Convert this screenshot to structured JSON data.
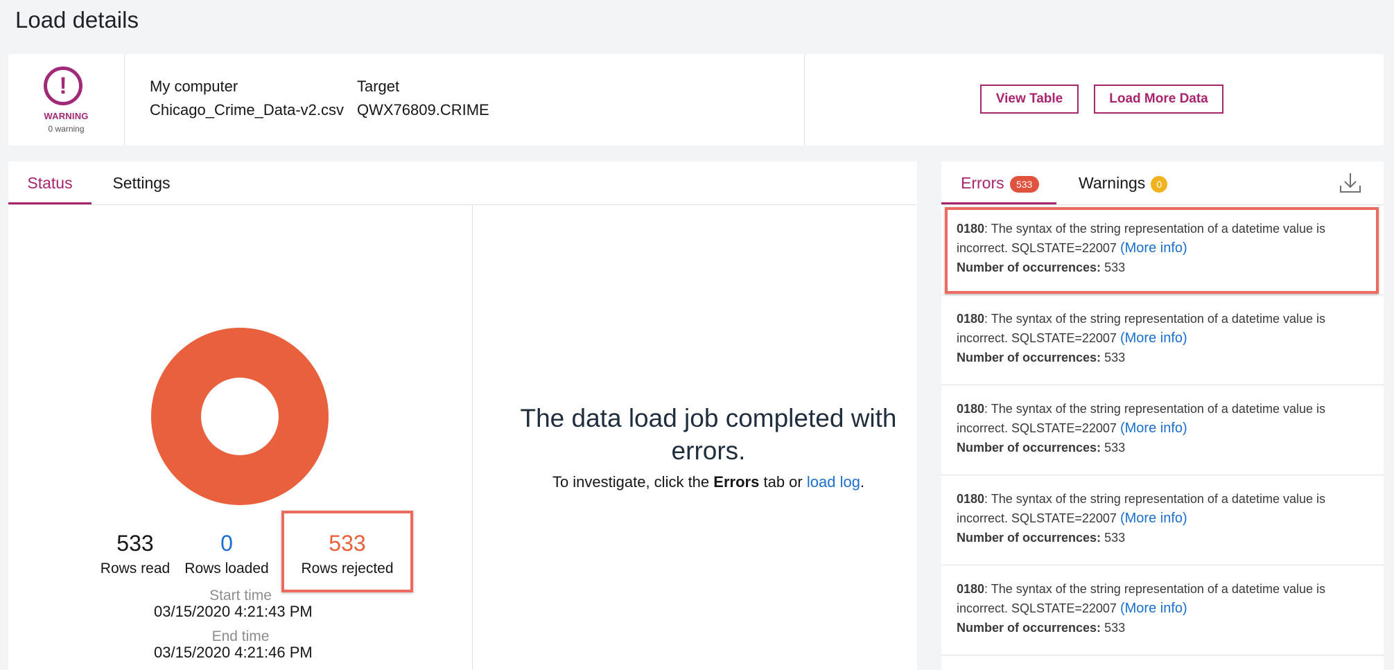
{
  "page": {
    "title": "Load details"
  },
  "summary": {
    "status_label": "WARNING",
    "status_count": "0 warning",
    "source_label": "My computer",
    "source_value": "Chicago_Crime_Data-v2.csv",
    "target_label": "Target",
    "target_value": "QWX76809.CRIME",
    "view_table_label": "View Table",
    "load_more_label": "Load More Data"
  },
  "main": {
    "tabs": [
      {
        "label": "Status"
      },
      {
        "label": "Settings"
      }
    ],
    "stats": {
      "rows_read": "533",
      "rows_read_label": "Rows read",
      "rows_loaded": "0",
      "rows_loaded_label": "Rows loaded",
      "rows_rejected": "533",
      "rows_rejected_label": "Rows rejected"
    },
    "start_time_label": "Start time",
    "start_time": "03/15/2020 4:21:43 PM",
    "end_time_label": "End time",
    "end_time": "03/15/2020 4:21:46 PM",
    "message_line1": "The data load job completed with",
    "message_line2": "errors.",
    "instruction_prefix": "To investigate, click the",
    "instruction_bold": "Errors",
    "instruction_middle": "tab or",
    "instruction_link": "load log",
    "instruction_suffix": "."
  },
  "errors_panel": {
    "errors_tab_label": "Errors",
    "errors_count": "533",
    "warnings_tab_label": "Warnings",
    "warnings_count": "0",
    "items": [
      {
        "code": "0180",
        "text": ": The syntax of the string representation of a datetime value is incorrect. SQLSTATE=22007",
        "link": "(More info)",
        "occ_label": "Number of occurrences:",
        "occ_value": "533"
      },
      {
        "code": "0180",
        "text": ": The syntax of the string representation of a datetime value is incorrect. SQLSTATE=22007",
        "link": "(More info)",
        "occ_label": "Number of occurrences:",
        "occ_value": "533"
      },
      {
        "code": "0180",
        "text": ": The syntax of the string representation of a datetime value is incorrect. SQLSTATE=22007",
        "link": "(More info)",
        "occ_label": "Number of occurrences:",
        "occ_value": "533"
      },
      {
        "code": "0180",
        "text": ": The syntax of the string representation of a datetime value is incorrect. SQLSTATE=22007",
        "link": "(More info)",
        "occ_label": "Number of occurrences:",
        "occ_value": "533"
      },
      {
        "code": "0180",
        "text": ": The syntax of the string representation of a datetime value is incorrect. SQLSTATE=22007",
        "link": "(More info)",
        "occ_label": "Number of occurrences:",
        "occ_value": "533"
      }
    ]
  },
  "colors": {
    "accent": "#a8246c",
    "error": "#e8603c",
    "link": "#1b6fcf",
    "warning_badge": "#f0b21d"
  },
  "chart_data": {
    "type": "pie",
    "categories": [
      "Rows loaded",
      "Rows rejected"
    ],
    "values": [
      0,
      533
    ],
    "colors": [
      "#1b6fcf",
      "#e8603c"
    ]
  }
}
